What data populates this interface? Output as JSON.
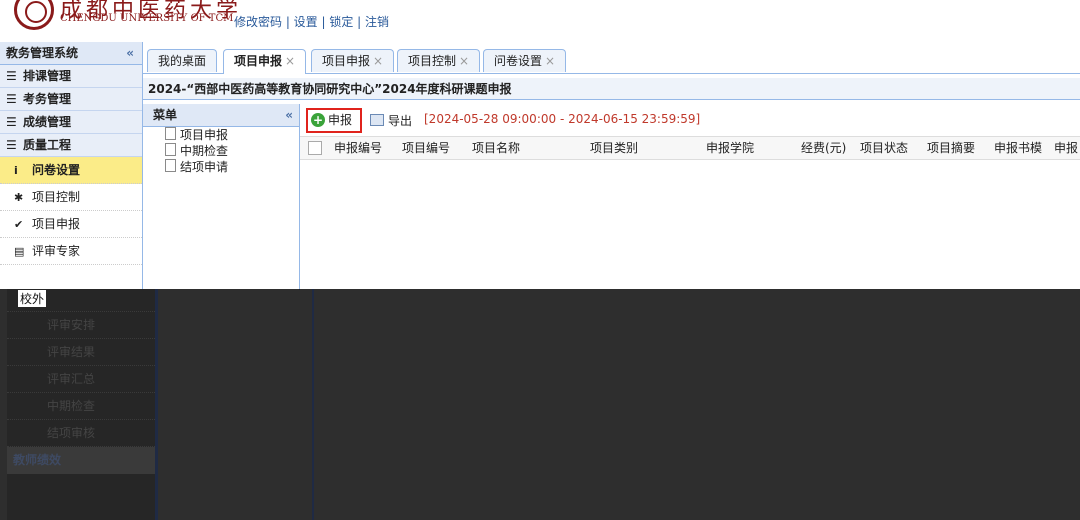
{
  "header": {
    "logo_cn": "成都中医药大学",
    "logo_en": "CHENGDU UNIVERSITY OF TCM",
    "links": "修改密码 | 设置 | 锁定 | 注销"
  },
  "sidebar": {
    "title": "教务管理系统",
    "collapse": "«",
    "groups": [
      "排课管理",
      "考务管理",
      "成绩管理",
      "质量工程"
    ],
    "items": [
      {
        "icon": "i",
        "label": "问卷设置"
      },
      {
        "icon": "✱",
        "label": "项目控制"
      },
      {
        "icon": "✔",
        "label": "项目申报"
      },
      {
        "icon": "▤",
        "label": "评审专家"
      }
    ],
    "dim_items": [
      "评审安排",
      "评审结果",
      "评审汇总",
      "中期检查",
      "结项审核"
    ],
    "dim_group": "教师绩效",
    "peek_label": "校外"
  },
  "tabs": [
    {
      "label": "我的桌面",
      "close": ""
    },
    {
      "label": "项目申报",
      "close": "×"
    },
    {
      "label": "项目申报",
      "close": "×"
    },
    {
      "label": "项目控制",
      "close": "×"
    },
    {
      "label": "问卷设置",
      "close": "×"
    }
  ],
  "page_title": "2024-“西部中医药高等教育协同研究中心”2024年度科研课题申报",
  "menu": {
    "title": "菜单",
    "collapse": "«",
    "items": [
      "项目申报",
      "中期检查",
      "结项申请"
    ]
  },
  "toolbar": {
    "apply": "申报",
    "export": "导出",
    "date_range": "[2024-05-28 09:00:00 - 2024-06-15 23:59:59]"
  },
  "table": {
    "columns": [
      "申报编号",
      "项目编号",
      "项目名称",
      "项目类别",
      "申报学院",
      "经费(元)",
      "项目状态",
      "项目摘要",
      "申报书模",
      "申报"
    ]
  }
}
